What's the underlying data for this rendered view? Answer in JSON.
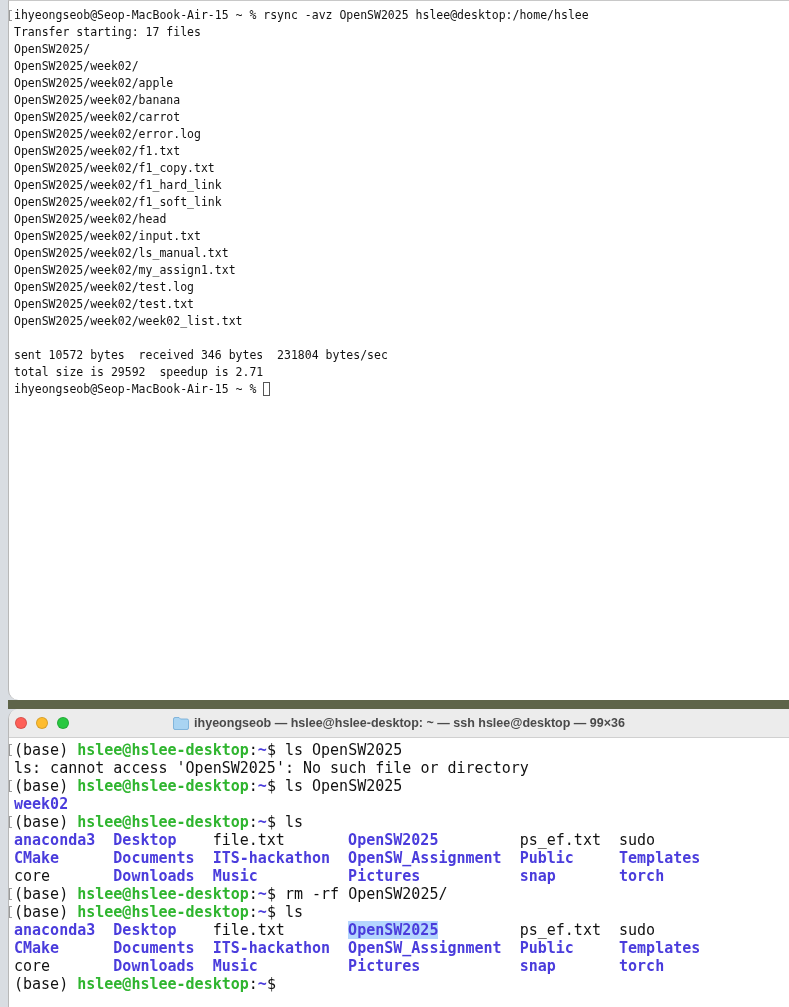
{
  "top_terminal": {
    "lines": [
      {
        "kind": "text",
        "text": "ihyeongseob@Seop-MacBook-Air-15 ~ % rsync -avz OpenSW2025 hslee@desktop:/home/hslee",
        "marked": true
      },
      {
        "kind": "text",
        "text": "Transfer starting: 17 files",
        "marked": false
      },
      {
        "kind": "text",
        "text": "OpenSW2025/",
        "marked": false
      },
      {
        "kind": "text",
        "text": "OpenSW2025/week02/",
        "marked": false
      },
      {
        "kind": "text",
        "text": "OpenSW2025/week02/apple",
        "marked": false
      },
      {
        "kind": "text",
        "text": "OpenSW2025/week02/banana",
        "marked": false
      },
      {
        "kind": "text",
        "text": "OpenSW2025/week02/carrot",
        "marked": false
      },
      {
        "kind": "text",
        "text": "OpenSW2025/week02/error.log",
        "marked": false
      },
      {
        "kind": "text",
        "text": "OpenSW2025/week02/f1.txt",
        "marked": false
      },
      {
        "kind": "text",
        "text": "OpenSW2025/week02/f1_copy.txt",
        "marked": false
      },
      {
        "kind": "text",
        "text": "OpenSW2025/week02/f1_hard_link",
        "marked": false
      },
      {
        "kind": "text",
        "text": "OpenSW2025/week02/f1_soft_link",
        "marked": false
      },
      {
        "kind": "text",
        "text": "OpenSW2025/week02/head",
        "marked": false
      },
      {
        "kind": "text",
        "text": "OpenSW2025/week02/input.txt",
        "marked": false
      },
      {
        "kind": "text",
        "text": "OpenSW2025/week02/ls_manual.txt",
        "marked": false
      },
      {
        "kind": "text",
        "text": "OpenSW2025/week02/my_assign1.txt",
        "marked": false
      },
      {
        "kind": "text",
        "text": "OpenSW2025/week02/test.log",
        "marked": false
      },
      {
        "kind": "text",
        "text": "OpenSW2025/week02/test.txt",
        "marked": false
      },
      {
        "kind": "text",
        "text": "OpenSW2025/week02/week02_list.txt",
        "marked": false
      },
      {
        "kind": "blank"
      },
      {
        "kind": "text",
        "text": "sent 10572 bytes  received 346 bytes  231804 bytes/sec",
        "marked": false
      },
      {
        "kind": "text",
        "text": "total size is 29592  speedup is 2.71",
        "marked": false
      },
      {
        "kind": "text",
        "text": "ihyeongseob@Seop-MacBook-Air-15 ~ %",
        "marked": false,
        "cursor": true
      }
    ]
  },
  "bottom_terminal": {
    "title": "ihyeongseob — hslee@hslee-desktop: ~ — ssh hslee@desktop — 99×36",
    "lines": [
      {
        "kind": "prompt",
        "marked": true,
        "env": "(base)",
        "user_host": "hslee@hslee-desktop",
        "separator": ":",
        "path": "~",
        "symbol": "$",
        "command": "ls OpenSW2025"
      },
      {
        "kind": "output",
        "text": "ls: cannot access 'OpenSW2025': No such file or directory"
      },
      {
        "kind": "prompt",
        "marked": true,
        "env": "(base)",
        "user_host": "hslee@hslee-desktop",
        "separator": ":",
        "path": "~",
        "symbol": "$",
        "command": "ls OpenSW2025"
      },
      {
        "kind": "listing",
        "cells": [
          {
            "name": "week02",
            "kind": "dir",
            "highlighted": false
          }
        ]
      },
      {
        "kind": "prompt",
        "marked": true,
        "env": "(base)",
        "user_host": "hslee@hslee-desktop",
        "separator": ":",
        "path": "~",
        "symbol": "$",
        "command": "ls"
      },
      {
        "kind": "listing",
        "cells": [
          {
            "name": "anaconda3",
            "kind": "dir",
            "highlighted": false
          },
          {
            "name": "Desktop",
            "kind": "dir",
            "highlighted": false
          },
          {
            "name": "file.txt",
            "kind": "file",
            "highlighted": false
          },
          {
            "name": "OpenSW2025",
            "kind": "dir",
            "highlighted": false
          },
          {
            "name": "ps_ef.txt",
            "kind": "file",
            "highlighted": false
          },
          {
            "name": "sudo",
            "kind": "file",
            "highlighted": false
          }
        ]
      },
      {
        "kind": "listing",
        "cells": [
          {
            "name": "CMake",
            "kind": "dir",
            "highlighted": false
          },
          {
            "name": "Documents",
            "kind": "dir",
            "highlighted": false
          },
          {
            "name": "ITS-hackathon",
            "kind": "dir",
            "highlighted": false
          },
          {
            "name": "OpenSW_Assignment",
            "kind": "dir",
            "highlighted": false
          },
          {
            "name": "Public",
            "kind": "dir",
            "highlighted": false
          },
          {
            "name": "Templates",
            "kind": "dir",
            "highlighted": false
          }
        ]
      },
      {
        "kind": "listing",
        "cells": [
          {
            "name": "core",
            "kind": "file",
            "highlighted": false
          },
          {
            "name": "Downloads",
            "kind": "dir",
            "highlighted": false
          },
          {
            "name": "Music",
            "kind": "dir",
            "highlighted": false
          },
          {
            "name": "Pictures",
            "kind": "dir",
            "highlighted": false
          },
          {
            "name": "snap",
            "kind": "dir",
            "highlighted": false
          },
          {
            "name": "torch",
            "kind": "dir",
            "highlighted": false
          }
        ]
      },
      {
        "kind": "prompt",
        "marked": true,
        "env": "(base)",
        "user_host": "hslee@hslee-desktop",
        "separator": ":",
        "path": "~",
        "symbol": "$",
        "command": "rm -rf OpenSW2025/"
      },
      {
        "kind": "prompt",
        "marked": true,
        "env": "(base)",
        "user_host": "hslee@hslee-desktop",
        "separator": ":",
        "path": "~",
        "symbol": "$",
        "command": "ls"
      },
      {
        "kind": "listing",
        "cells": [
          {
            "name": "anaconda3",
            "kind": "dir",
            "highlighted": false
          },
          {
            "name": "Desktop",
            "kind": "dir",
            "highlighted": false
          },
          {
            "name": "file.txt",
            "kind": "file",
            "highlighted": false
          },
          {
            "name": "OpenSW2025",
            "kind": "dir",
            "highlighted": true
          },
          {
            "name": "ps_ef.txt",
            "kind": "file",
            "highlighted": false
          },
          {
            "name": "sudo",
            "kind": "file",
            "highlighted": false
          }
        ]
      },
      {
        "kind": "listing",
        "cells": [
          {
            "name": "CMake",
            "kind": "dir",
            "highlighted": false
          },
          {
            "name": "Documents",
            "kind": "dir",
            "highlighted": false
          },
          {
            "name": "ITS-hackathon",
            "kind": "dir",
            "highlighted": false
          },
          {
            "name": "OpenSW_Assignment",
            "kind": "dir",
            "highlighted": false
          },
          {
            "name": "Public",
            "kind": "dir",
            "highlighted": false
          },
          {
            "name": "Templates",
            "kind": "dir",
            "highlighted": false
          }
        ]
      },
      {
        "kind": "listing",
        "cells": [
          {
            "name": "core",
            "kind": "file",
            "highlighted": false
          },
          {
            "name": "Downloads",
            "kind": "dir",
            "highlighted": false
          },
          {
            "name": "Music",
            "kind": "dir",
            "highlighted": false
          },
          {
            "name": "Pictures",
            "kind": "dir",
            "highlighted": false
          },
          {
            "name": "snap",
            "kind": "dir",
            "highlighted": false
          },
          {
            "name": "torch",
            "kind": "dir",
            "highlighted": false
          }
        ]
      },
      {
        "kind": "prompt",
        "marked": false,
        "env": "(base)",
        "user_host": "hslee@hslee-desktop",
        "separator": ":",
        "path": "~",
        "symbol": "$"
      }
    ]
  }
}
